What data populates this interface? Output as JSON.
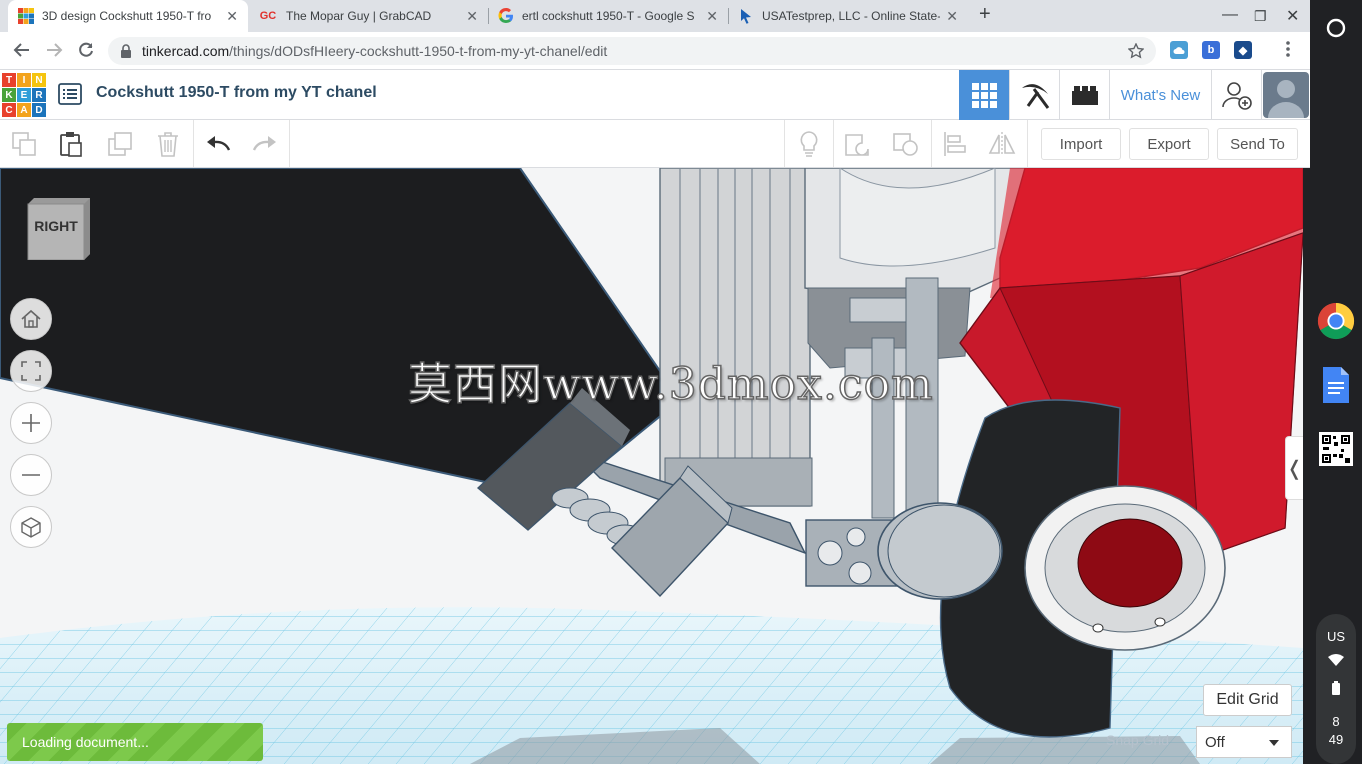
{
  "browser": {
    "tabs": [
      {
        "title": "3D design Cockshutt 1950-T fro",
        "favicon": "tinkercad-favicon",
        "active": true
      },
      {
        "title": "The Mopar Guy | GrabCAD",
        "favicon_text": "GC",
        "active": false
      },
      {
        "title": "ertl cockshutt 1950-T - Google S",
        "favicon": "google-favicon",
        "active": false
      },
      {
        "title": "USATestprep, LLC - Online State-S",
        "favicon": "cursor-favicon",
        "active": false
      }
    ],
    "close_glyph": "✕",
    "new_tab_glyph": "+",
    "window_controls": {
      "minimize": "—",
      "restore": "❐",
      "close": "✕"
    },
    "url_host": "tinkercad.com",
    "url_path": "/things/dODsfHIeery-cockshutt-1950-t-from-my-yt-chanel/edit",
    "extensions": [
      {
        "label": "",
        "color": "#4b9fd5"
      },
      {
        "label": "b",
        "color": "#3a6fd8"
      },
      {
        "label": "◆",
        "color": "#1a4b8c"
      }
    ]
  },
  "app": {
    "logo_letters": [
      "T",
      "I",
      "N",
      "K",
      "E",
      "R",
      "C",
      "A",
      "D"
    ],
    "logo_colors": [
      "#e8412c",
      "#f3a31c",
      "#f5c40f",
      "#4aa23a",
      "#2f9ed8",
      "#1c74bb",
      "#e8412c",
      "#f3a31c",
      "#1c74bb"
    ],
    "title": "Cockshutt 1950-T from my YT chanel",
    "whats_new": "What's New",
    "accent": "#4a90d9"
  },
  "toolbar": {
    "import_label": "Import",
    "export_label": "Export",
    "send_to_label": "Send To"
  },
  "viewport": {
    "viewcube_label": "RIGHT",
    "watermark": "莫西网www.3dmox.com",
    "loading_text": "Loading document...",
    "edit_grid_label": "Edit Grid",
    "snap_grid_label": "Snap Grid",
    "snap_grid_value": "Off"
  },
  "shelf": {
    "locale": "US",
    "time_hour": "8",
    "time_minute": "49"
  }
}
